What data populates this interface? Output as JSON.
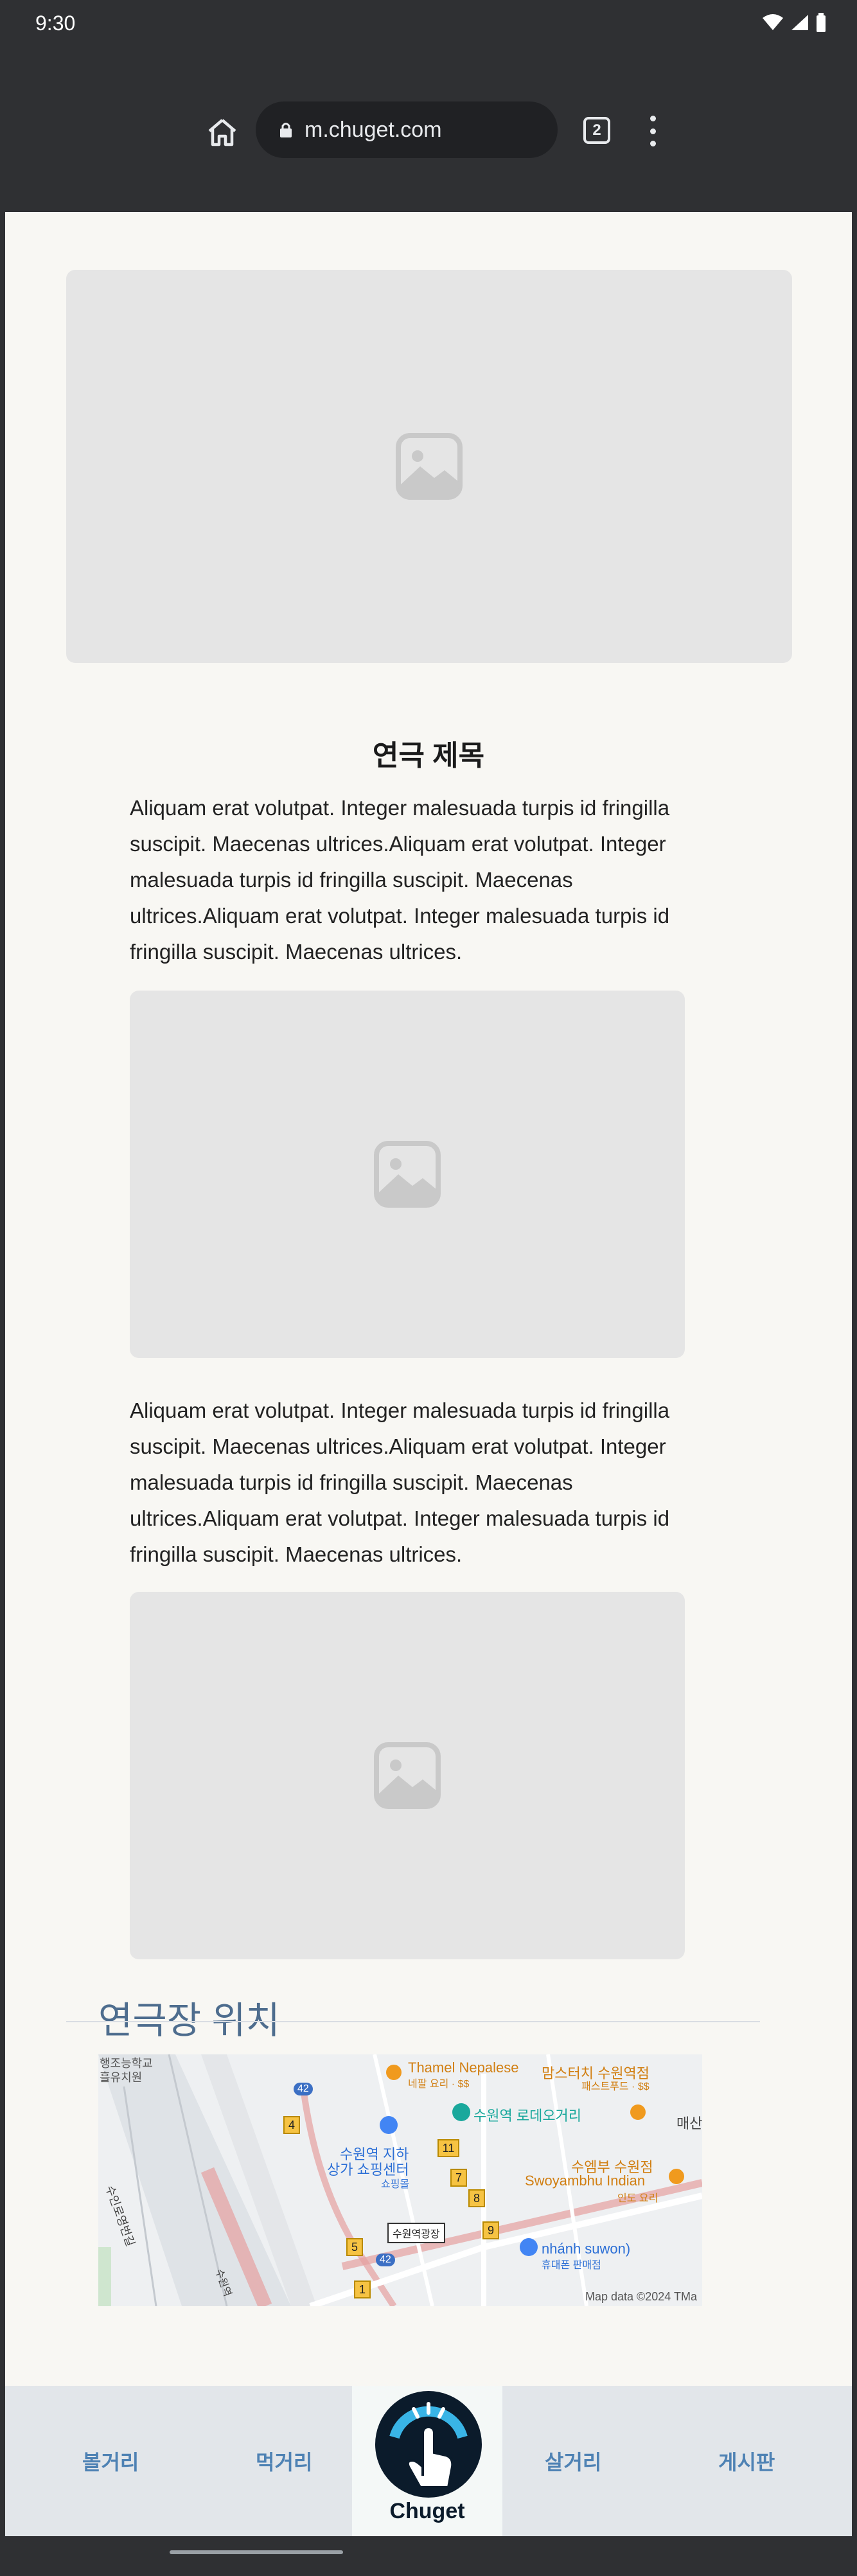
{
  "status": {
    "time": "9:30"
  },
  "browser": {
    "url": "m.chuget.com",
    "tab_count": "2"
  },
  "content": {
    "title": "연극 제목",
    "paragraph_1": "Aliquam erat volutpat. Integer malesuada turpis id fringilla suscipit. Maecenas ultrices.Aliquam erat volutpat. Integer malesuada turpis id fringilla suscipit. Maecenas ultrices.Aliquam erat volutpat. Integer malesuada turpis id fringilla suscipit. Maecenas ultrices.",
    "paragraph_2": "Aliquam erat volutpat. Integer malesuada turpis id fringilla suscipit. Maecenas ultrices.Aliquam erat volutpat. Integer malesuada turpis id fringilla suscipit. Maecenas ultrices.Aliquam erat volutpat. Integer malesuada turpis id fringilla suscipit. Maecenas ultrices."
  },
  "location": {
    "heading": "연극장 위치",
    "map": {
      "credit": "Map data ©2024 TMa",
      "labels": {
        "thamel": "Thamel Nepalese",
        "thamel_sub": "네팔 요리 · $$",
        "momstouch": "맘스터치 수원역점",
        "momstouch_sub": "패스트푸드 · $$",
        "rodeo": "수원역 로데오거리",
        "underground": "수원역 지하",
        "underground_2": "상가 쇼핑센터",
        "underground_sub": "쇼핑몰",
        "swoyambhu": "수엠부 수원점",
        "swoyambhu_en": "Swoyambhu Indian",
        "swoyambhu_sub": "인도 요리",
        "nhanh": "nhánh suwon)",
        "nhanh_sub": "휴대폰 판매점",
        "station": "수원역광장",
        "school": "행조능학교",
        "kinder": "흘유치원",
        "road1": "수인로영번길",
        "road2": "수원역",
        "east": "매산"
      },
      "exits": [
        "4",
        "11",
        "7",
        "8",
        "9",
        "5",
        "1"
      ],
      "bus": [
        "42",
        "42"
      ]
    }
  },
  "nav": {
    "item_1": "볼거리",
    "item_2": "먹거리",
    "logo": "Chuget",
    "item_3": "살거리",
    "item_4": "게시판"
  },
  "colors": {
    "accent": "#4e82b4",
    "heading": "#4e6d8e",
    "logo": "#0b1b2b",
    "logo_highlight": "#39b4e6"
  },
  "icons": [
    "home-icon",
    "lock-icon",
    "tabs-icon",
    "menu-icon",
    "image-placeholder-icon",
    "wifi-icon",
    "signal-icon",
    "battery-icon"
  ]
}
